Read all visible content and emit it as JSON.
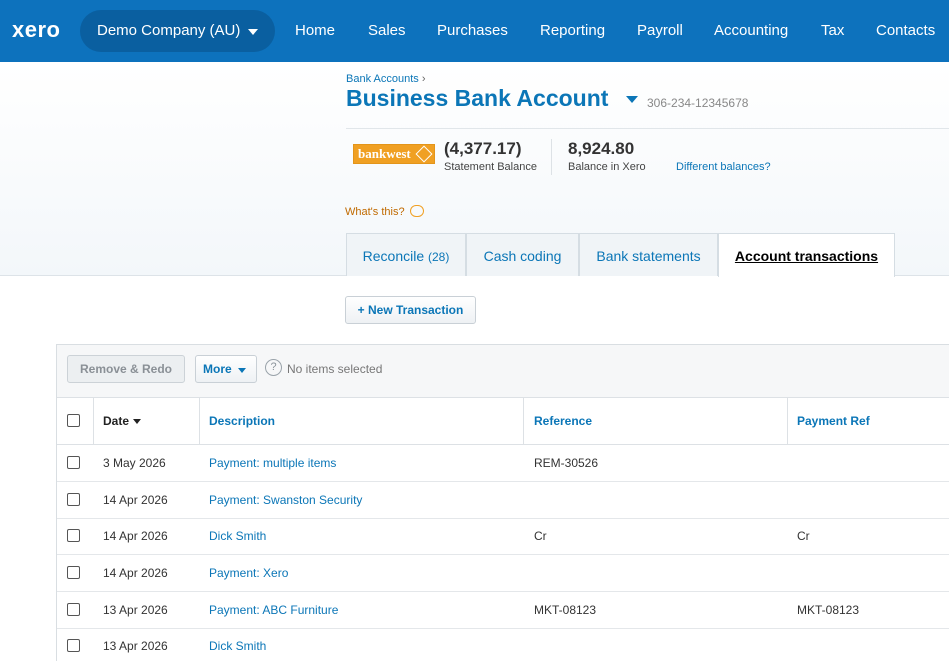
{
  "topbar": {
    "logo": "xero",
    "org_name": "Demo Company (AU)",
    "nav": [
      "Home",
      "Sales",
      "Purchases",
      "Reporting",
      "Payroll",
      "Accounting",
      "Tax",
      "Contacts"
    ]
  },
  "header": {
    "breadcrumb": "Bank Accounts",
    "breadcrumb_sep": "›",
    "title": "Business Bank Account",
    "account_number": "306-234-12345678",
    "bank_logo_text": "bankwest",
    "statement_balance": "(4,377.17)",
    "statement_balance_label": "Statement Balance",
    "xero_balance": "8,924.80",
    "xero_balance_label": "Balance in Xero",
    "different_balances": "Different balances?",
    "whats_this": "What's this?"
  },
  "tabs": [
    {
      "label": "Reconcile",
      "count": "(28)"
    },
    {
      "label": "Cash coding"
    },
    {
      "label": "Bank statements"
    },
    {
      "label": "Account transactions"
    }
  ],
  "new_transaction": "+ New Transaction",
  "toolbar": {
    "remove_redo": "Remove & Redo",
    "more": "More",
    "help_glyph": "?",
    "selection_status": "No items selected"
  },
  "table": {
    "columns": [
      "Date",
      "Description",
      "Reference",
      "Payment Ref"
    ],
    "rows": [
      {
        "date": "3 May 2026",
        "description": "Payment: multiple items",
        "reference": "REM-30526",
        "payment_ref": ""
      },
      {
        "date": "14 Apr 2026",
        "description": "Payment: Swanston Security",
        "reference": "",
        "payment_ref": ""
      },
      {
        "date": "14 Apr 2026",
        "description": "Dick Smith",
        "reference": "Cr",
        "payment_ref": "Cr"
      },
      {
        "date": "14 Apr 2026",
        "description": "Payment: Xero",
        "reference": "",
        "payment_ref": ""
      },
      {
        "date": "13 Apr 2026",
        "description": "Payment: ABC Furniture",
        "reference": "MKT-08123",
        "payment_ref": "MKT-08123"
      },
      {
        "date": "13 Apr 2026",
        "description": "Dick Smith",
        "reference": "",
        "payment_ref": ""
      }
    ]
  },
  "colors": {
    "nav_blue": "#0d72bd",
    "link_blue": "#0b76b7",
    "bankwest_orange": "#f0a023"
  }
}
